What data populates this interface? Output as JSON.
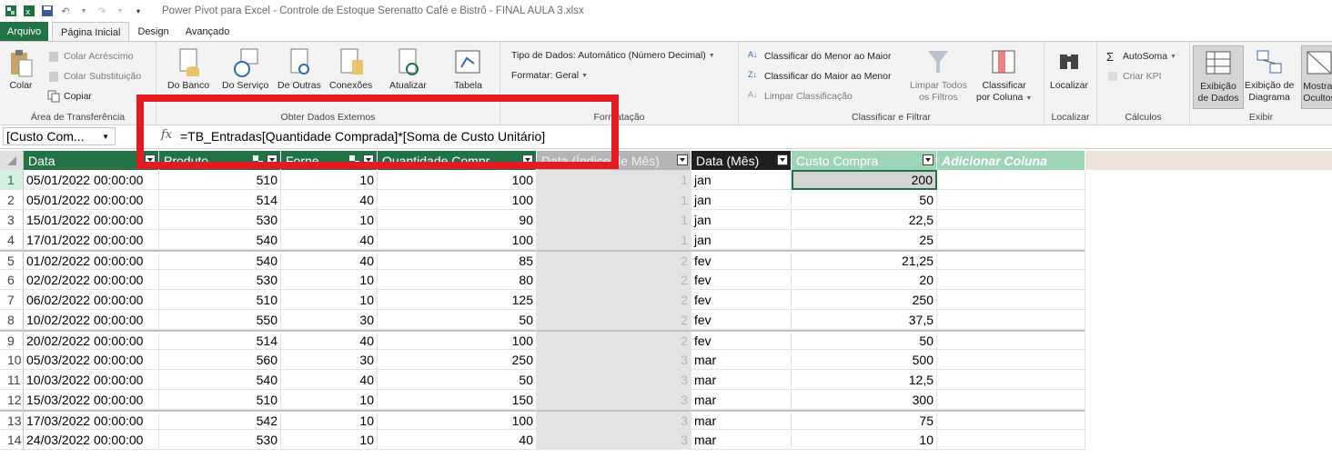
{
  "window": {
    "title": "Power Pivot para Excel - Controle de Estoque Serenatto Café e Bistrô - FINAL AULA 3.xlsx"
  },
  "tabs": [
    {
      "label": "Arquivo"
    },
    {
      "label": "Página Inicial"
    },
    {
      "label": "Design"
    },
    {
      "label": "Avançado"
    }
  ],
  "ribbon": {
    "clipboard": {
      "paste": "Colar",
      "paste_append": "Colar Acréscimo",
      "paste_replace": "Colar Substituição",
      "copy": "Copiar",
      "group": "Área de Transferência"
    },
    "external": {
      "from_db": "Do Banco",
      "from_service": "Do Serviço",
      "from_other": "De Outras",
      "connections": "Conexões",
      "refresh": "Atualizar",
      "table": "Tabela",
      "group": "Obter Dados Externos"
    },
    "format": {
      "data_type": "Tipo de Dados: Automático (Número Decimal)",
      "format": "Formatar: Geral",
      "group": "Formatação"
    },
    "sort": {
      "asc": "Classificar do Menor ao Maior",
      "desc": "Classificar do Maior ao Menor",
      "clear": "Limpar Classificação",
      "clear_filters_1": "Limpar Todos",
      "clear_filters_2": "os Filtros",
      "sort_col_1": "Classificar",
      "sort_col_2": "por Coluna",
      "group": "Classificar e Filtrar"
    },
    "find": {
      "find": "Localizar",
      "group": "Localizar"
    },
    "calc": {
      "autosum": "AutoSoma",
      "kpi": "Criar KPI",
      "group": "Cálculos"
    },
    "view": {
      "data_view_1": "Exibição",
      "data_view_2": "de Dados",
      "diagram_1": "Exibição de",
      "diagram_2": "Diagrama",
      "hidden_1": "Mostrar",
      "hidden_2": "Ocultos",
      "group": "Exibir"
    }
  },
  "formula_bar": {
    "name_box": "[Custo Com...",
    "fx": "fx",
    "formula": "=TB_Entradas[Quantidade Comprada]*[Soma de Custo Unitário]"
  },
  "columns": [
    {
      "label": "Data"
    },
    {
      "label": "Produto"
    },
    {
      "label": "Forne..."
    },
    {
      "label": "Quantidade Compr..."
    },
    {
      "label": "Data (Índice de Mês)"
    },
    {
      "label": "Data (Mês)"
    },
    {
      "label": "Custo Compra"
    },
    {
      "label": "Adicionar Coluna"
    }
  ],
  "rows": [
    {
      "n": "1",
      "data": "05/01/2022 00:00:00",
      "produto": "510",
      "forn": "10",
      "qtd": "100",
      "idx": "1",
      "mes": "jan",
      "custo": "200"
    },
    {
      "n": "2",
      "data": "05/01/2022 00:00:00",
      "produto": "514",
      "forn": "40",
      "qtd": "100",
      "idx": "1",
      "mes": "jan",
      "custo": "50"
    },
    {
      "n": "3",
      "data": "15/01/2022 00:00:00",
      "produto": "530",
      "forn": "10",
      "qtd": "90",
      "idx": "1",
      "mes": "jan",
      "custo": "22,5"
    },
    {
      "n": "4",
      "data": "17/01/2022 00:00:00",
      "produto": "540",
      "forn": "40",
      "qtd": "100",
      "idx": "1",
      "mes": "jan",
      "custo": "25"
    },
    {
      "n": "5",
      "data": "01/02/2022 00:00:00",
      "produto": "540",
      "forn": "40",
      "qtd": "85",
      "idx": "2",
      "mes": "fev",
      "custo": "21,25"
    },
    {
      "n": "6",
      "data": "02/02/2022 00:00:00",
      "produto": "530",
      "forn": "10",
      "qtd": "80",
      "idx": "2",
      "mes": "fev",
      "custo": "20"
    },
    {
      "n": "7",
      "data": "06/02/2022 00:00:00",
      "produto": "510",
      "forn": "10",
      "qtd": "125",
      "idx": "2",
      "mes": "fev",
      "custo": "250"
    },
    {
      "n": "8",
      "data": "10/02/2022 00:00:00",
      "produto": "550",
      "forn": "30",
      "qtd": "50",
      "idx": "2",
      "mes": "fev",
      "custo": "37,5"
    },
    {
      "n": "9",
      "data": "20/02/2022 00:00:00",
      "produto": "514",
      "forn": "40",
      "qtd": "100",
      "idx": "2",
      "mes": "fev",
      "custo": "50"
    },
    {
      "n": "10",
      "data": "05/03/2022 00:00:00",
      "produto": "560",
      "forn": "30",
      "qtd": "250",
      "idx": "3",
      "mes": "mar",
      "custo": "500"
    },
    {
      "n": "11",
      "data": "10/03/2022 00:00:00",
      "produto": "540",
      "forn": "40",
      "qtd": "50",
      "idx": "3",
      "mes": "mar",
      "custo": "12,5"
    },
    {
      "n": "12",
      "data": "15/03/2022 00:00:00",
      "produto": "510",
      "forn": "10",
      "qtd": "150",
      "idx": "3",
      "mes": "mar",
      "custo": "300"
    },
    {
      "n": "13",
      "data": "17/03/2022 00:00:00",
      "produto": "542",
      "forn": "10",
      "qtd": "100",
      "idx": "3",
      "mes": "mar",
      "custo": "75"
    },
    {
      "n": "14",
      "data": "24/03/2022 00:00:00",
      "produto": "530",
      "forn": "10",
      "qtd": "40",
      "idx": "3",
      "mes": "mar",
      "custo": "10"
    }
  ],
  "colors": {
    "accent": "#217346",
    "highlight": "#e01b22"
  }
}
